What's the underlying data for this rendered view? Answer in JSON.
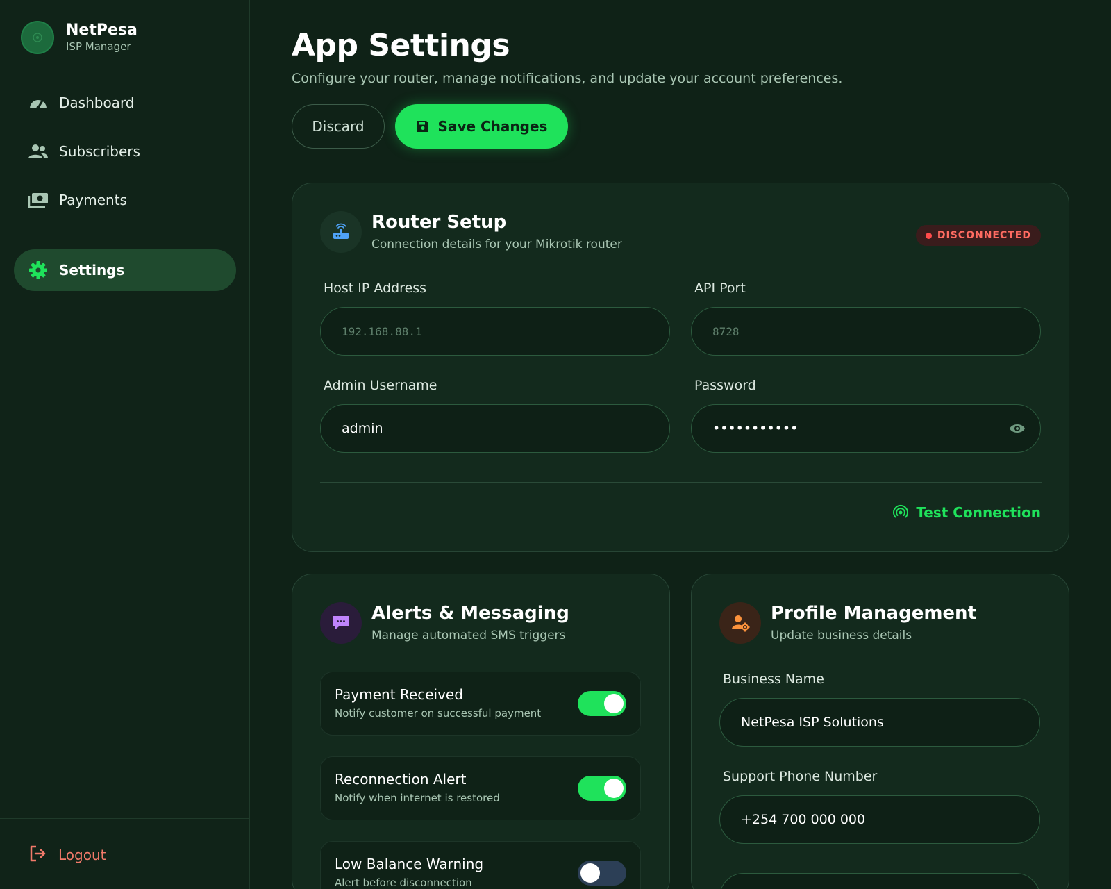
{
  "brand": {
    "name": "NetPesa",
    "subtitle": "ISP Manager"
  },
  "sidebar": {
    "items": [
      {
        "label": "Dashboard",
        "icon": "gauge-icon",
        "active": false
      },
      {
        "label": "Subscribers",
        "icon": "users-icon",
        "active": false
      },
      {
        "label": "Payments",
        "icon": "money-icon",
        "active": false
      },
      {
        "label": "Settings",
        "icon": "gear-icon",
        "active": true
      }
    ],
    "logout_label": "Logout"
  },
  "header": {
    "title": "App Settings",
    "subtitle": "Configure your router, manage notifications, and update your account preferences.",
    "discard_label": "Discard",
    "save_label": "Save Changes"
  },
  "router": {
    "title": "Router Setup",
    "subtitle": "Connection details for your Mikrotik router",
    "status": "DISCONNECTED",
    "host_label": "Host IP Address",
    "host_placeholder": "192.168.88.1",
    "port_label": "API Port",
    "port_placeholder": "8728",
    "username_label": "Admin Username",
    "username_value": "admin",
    "password_label": "Password",
    "password_value": "•••••••••••",
    "test_label": "Test Connection"
  },
  "alerts": {
    "title": "Alerts & Messaging",
    "subtitle": "Manage automated SMS triggers",
    "items": [
      {
        "title": "Payment Received",
        "desc": "Notify customer on successful payment",
        "enabled": true
      },
      {
        "title": "Reconnection Alert",
        "desc": "Notify when internet is restored",
        "enabled": true
      },
      {
        "title": "Low Balance Warning",
        "desc": "Alert before disconnection",
        "enabled": false
      }
    ]
  },
  "profile": {
    "title": "Profile Management",
    "subtitle": "Update business details",
    "business_label": "Business Name",
    "business_value": "NetPesa ISP Solutions",
    "phone_label": "Support Phone Number",
    "phone_value": "+254 700 000 000"
  },
  "colors": {
    "accent": "#1fe25b",
    "background": "#0f2217",
    "card": "#132a1d",
    "danger": "#ff4b4b",
    "toggle_off": "#2c3f56"
  }
}
